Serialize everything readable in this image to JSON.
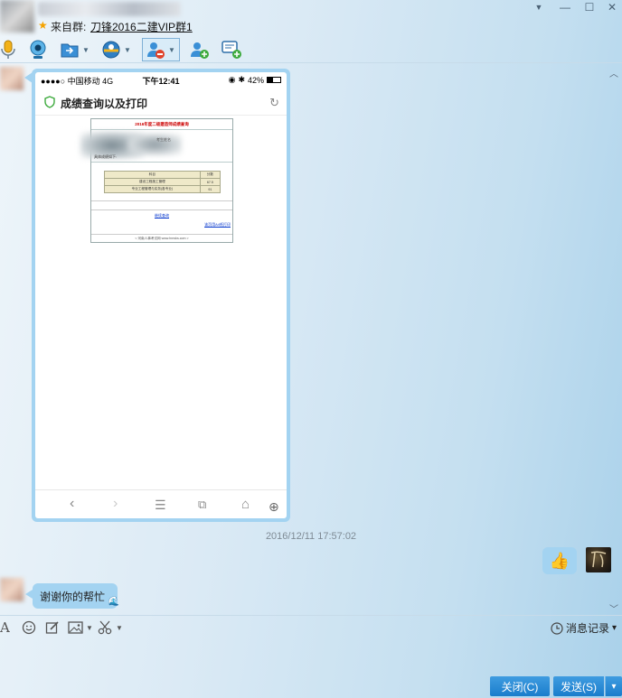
{
  "titlebar": {
    "group_prefix": "来自群:",
    "group_name": "刀锋2016二建VIP群1",
    "buttons": {
      "menu": "▼",
      "minimize": "—",
      "maximize": "☐",
      "close": "✕"
    }
  },
  "toolbar": {
    "items": [
      "microphone-icon",
      "video-camera-icon",
      "file-transfer-icon",
      "remote-assist-icon",
      "block-user-icon",
      "add-friend-icon",
      "create-discussion-icon"
    ]
  },
  "phone_screenshot": {
    "carrier": "●●●●○ 中国移动  4G",
    "time": "下午12:41",
    "battery": "42%",
    "battery_level": 0.42,
    "page_title": "成绩查询以及打印",
    "score_page": {
      "heading": "2016年度二级建造师成绩查询",
      "name_label": "考生姓名",
      "score_label": "具体成绩如下:",
      "table": [
        [
          "科目",
          "分数"
        ],
        [
          "建设工程施工管理",
          "67.5"
        ],
        [
          "专业工程管理与实务(各专业)",
          "91"
        ]
      ],
      "query_link": "继续查询",
      "print_link": "该页用A4纸打印",
      "footer": "< 河南人事考试网 www.hnrsks.com >"
    }
  },
  "chat": {
    "timestamp": "2016/12/11 17:57:02",
    "thumbs_up_emoji": "👍",
    "message": "谢谢你的帮忙",
    "message_emoji": "🌊"
  },
  "input_toolbar": {
    "font_icon": "A",
    "history_label": "消息记录",
    "history_caret": "▾"
  },
  "buttons": {
    "close_label": "关闭(C)",
    "send_label": "发送(S)",
    "send_menu": "▾"
  },
  "colors": {
    "bubble": "#a3d3f1",
    "button": "#1a7dcc"
  }
}
